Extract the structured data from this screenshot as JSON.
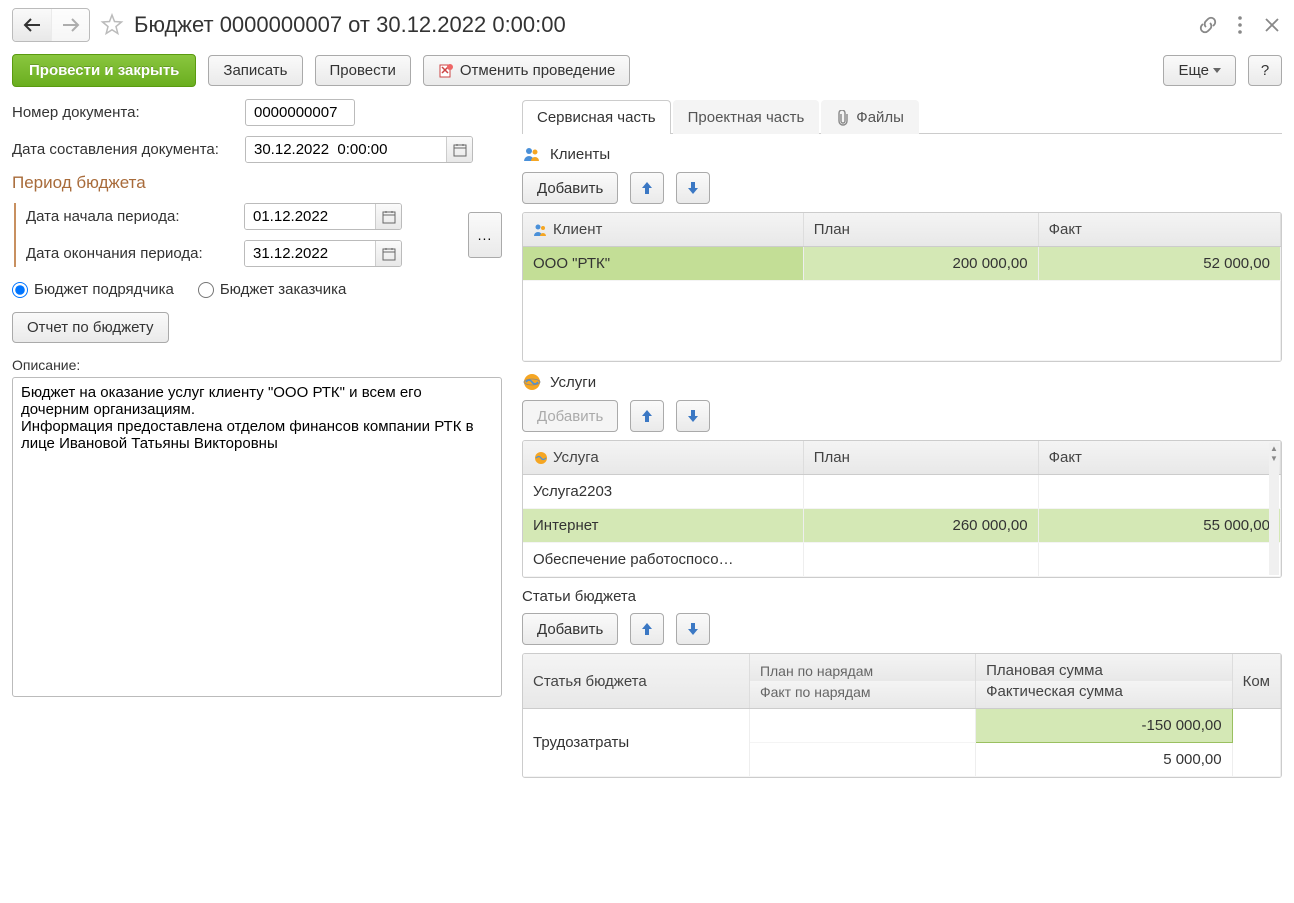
{
  "header": {
    "title": "Бюджет 0000000007 от 30.12.2022 0:00:00"
  },
  "toolbar": {
    "post_close": "Провести и закрыть",
    "save": "Записать",
    "post": "Провести",
    "cancel_post": "Отменить проведение",
    "more": "Еще",
    "help": "?"
  },
  "fields": {
    "doc_num_label": "Номер документа:",
    "doc_num": "0000000007",
    "doc_date_label": "Дата составления документа:",
    "doc_date": "30.12.2022  0:00:00",
    "period_title": "Период бюджета",
    "period_start_label": "Дата начала периода:",
    "period_start": "01.12.2022",
    "period_end_label": "Дата окончания периода:",
    "period_end": "31.12.2022",
    "budget_contractor": "Бюджет подрядчика",
    "budget_customer": "Бюджет заказчика",
    "report_btn": "Отчет по бюджету",
    "desc_label": "Описание:",
    "desc": "Бюджет на оказание услуг клиенту \"ООО РТК\" и всем его дочерним организациям.\nИнформация предоставлена отделом финансов компании РТК в лице Ивановой Татьяны Викторовны"
  },
  "tabs": {
    "service": "Сервисная часть",
    "project": "Проектная часть",
    "files": "Файлы"
  },
  "clients": {
    "title": "Клиенты",
    "add": "Добавить",
    "cols": {
      "client": "Клиент",
      "plan": "План",
      "fact": "Факт"
    },
    "rows": [
      {
        "client": "ООО \"РТК\"",
        "plan": "200 000,00",
        "fact": "52 000,00"
      }
    ]
  },
  "services": {
    "title": "Услуги",
    "add": "Добавить",
    "cols": {
      "service": "Услуга",
      "plan": "План",
      "fact": "Факт"
    },
    "rows": [
      {
        "service": "Услуга2203",
        "plan": "",
        "fact": ""
      },
      {
        "service": "Интернет",
        "plan": "260 000,00",
        "fact": "55 000,00"
      },
      {
        "service": "Обеспечение работоспосо…",
        "plan": "",
        "fact": ""
      }
    ]
  },
  "budget": {
    "title": "Статьи бюджета",
    "add": "Добавить",
    "cols": {
      "item": "Статья бюджета",
      "plan_orders": "План по нарядам",
      "fact_orders": "Факт по нарядам",
      "plan_sum": "Плановая сумма",
      "fact_sum": "Фактическая сумма",
      "comment": "Ком"
    },
    "rows": [
      {
        "item": "Трудозатраты",
        "plan_sum": "-150 000,00",
        "fact_sum": "5 000,00"
      }
    ]
  }
}
